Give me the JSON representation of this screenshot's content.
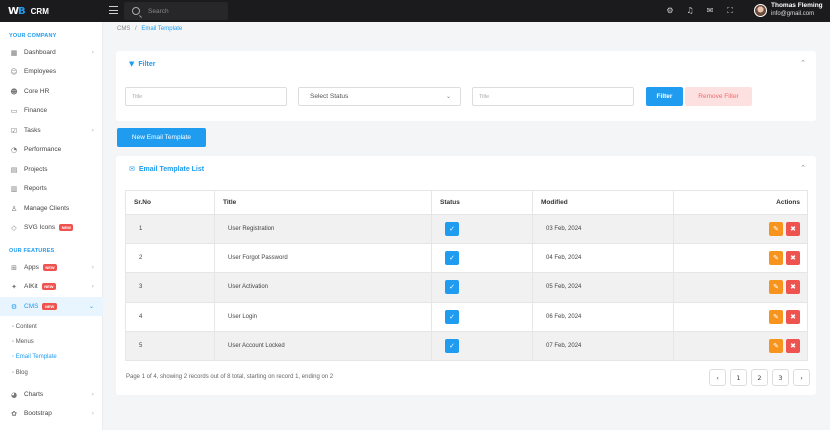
{
  "brand": {
    "logo": "WB",
    "name": "CRM"
  },
  "search": {
    "placeholder": "Search"
  },
  "user": {
    "name": "Thomas Fleming",
    "email": "info@gmail.com"
  },
  "sidebar": {
    "section1": "YOUR COMPANY",
    "items1": [
      {
        "label": "Dashboard",
        "icon": "grid-icon"
      },
      {
        "label": "Employees",
        "icon": "users-icon"
      },
      {
        "label": "Core HR",
        "icon": "user-icon"
      },
      {
        "label": "Finance",
        "icon": "wallet-icon"
      },
      {
        "label": "Tasks",
        "icon": "tasks-icon"
      },
      {
        "label": "Performance",
        "icon": "gauge-icon"
      },
      {
        "label": "Projects",
        "icon": "folder-icon"
      },
      {
        "label": "Reports",
        "icon": "report-icon"
      },
      {
        "label": "Manage Clients",
        "icon": "clients-icon"
      },
      {
        "label": "SVG Icons",
        "icon": "svg-icon",
        "badge": "NEW"
      }
    ],
    "section2": "OUR FEATURES",
    "items2": [
      {
        "label": "Apps",
        "icon": "apps-icon",
        "badge": "NEW"
      },
      {
        "label": "AIKit",
        "icon": "ai-icon",
        "badge": "NEW"
      },
      {
        "label": "CMS",
        "icon": "cms-icon",
        "badge": "NEW"
      }
    ],
    "cms_sub": [
      "Content",
      "Menus",
      "Email Template",
      "Blog"
    ],
    "items3": [
      {
        "label": "Charts",
        "icon": "chart-icon"
      },
      {
        "label": "Bootstrap",
        "icon": "bootstrap-icon"
      }
    ]
  },
  "breadcrumb": {
    "parent": "CMS",
    "sep": "/",
    "current": "Email Template"
  },
  "filter": {
    "title": "Filter",
    "title_placeholder": "Title",
    "status_placeholder": "Select Status",
    "title2_placeholder": "Title",
    "filter_button": "Filter",
    "remove_button": "Remove Filter"
  },
  "new_button": "New Email Template",
  "list": {
    "title": "Email Template List",
    "headers": [
      "Sr.No",
      "Title",
      "Status",
      "Modified",
      "Actions"
    ],
    "rows": [
      {
        "sr": "1",
        "title": "User Registration",
        "modified": "03 Feb, 2024"
      },
      {
        "sr": "2",
        "title": "User Forgot Password",
        "modified": "04 Feb, 2024"
      },
      {
        "sr": "3",
        "title": "User Activation",
        "modified": "05 Feb, 2024"
      },
      {
        "sr": "4",
        "title": "User Login",
        "modified": "06 Feb, 2024"
      },
      {
        "sr": "5",
        "title": "User Account Locked",
        "modified": "07 Feb, 2024"
      }
    ],
    "pagination_info": "Page 1 of 4, showing 2 records out of 8 total, starting on record 1, ending on 2",
    "pages": [
      "1",
      "2",
      "3"
    ]
  },
  "colors": {
    "accent": "#1f9cf0",
    "edit": "#f7941d",
    "delete": "#ef5350"
  }
}
